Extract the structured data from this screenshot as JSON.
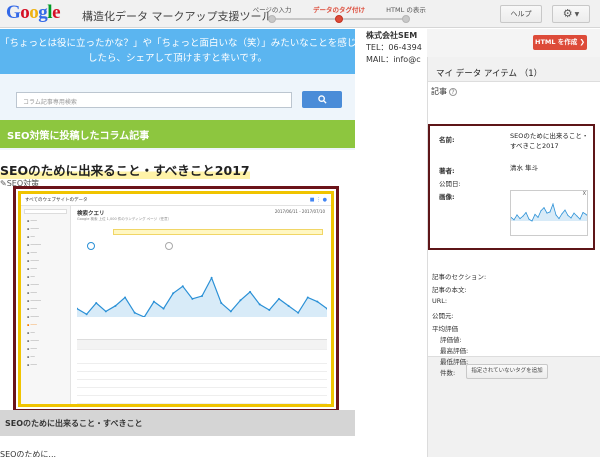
{
  "header": {
    "logo": [
      "G",
      "o",
      "o",
      "g",
      "l",
      "e"
    ],
    "title": "構造化データ マークアップ支援ツール",
    "steps": [
      "ページの入力",
      "データのタグ付け",
      "HTML の表示"
    ],
    "active_step": 1,
    "help_label": "ヘルプ",
    "gear_icon": "gear-icon"
  },
  "preview": {
    "banner_line1": "「ちょっとは役に立ったかな？」や「ちょっと面白いな（笑）」みたいなことを感じられま",
    "banner_line2": "したら、シェアして頂けますと幸いです。",
    "search_placeholder": "コラム記事専用検索",
    "search_icon": "magnifier-icon",
    "section_heading": "SEO対策に投稿したコラム記事",
    "post_title": "SEOのために出来ること・すべきこと2017",
    "post_category": "SEO対策",
    "next_heading": "SEOのために出来ること・すべきこと",
    "next_item": "SEOのために..."
  },
  "company": {
    "name": "株式会社SEM",
    "tel": "TEL：06-4394",
    "mail": "MAIL：info@c"
  },
  "html_button": "HTML を作成 ❯",
  "panel": {
    "title": "マイ データ アイテム （1）",
    "section": "記事",
    "fields": {
      "name_label": "名前:",
      "name_value": "SEOのために出来ること・すべきこと2017",
      "author_label": "著者:",
      "author_value": "清水 隼斗",
      "published_label": "公開日:",
      "image_label": "画像:",
      "section_label": "記事のセクション:",
      "body_label": "記事の本文:",
      "url_label": "URL:",
      "publisher_label": "公開元:",
      "rating_label": "平均評価",
      "rating_value_label": "評価値:",
      "best_label": "最高評価:",
      "worst_label": "最低評価:",
      "count_label": "件数:"
    },
    "add_button": "指定されていないタグを追加"
  },
  "ga_mock": {
    "brand": "すべてのウェブサイトのデータ",
    "heading": "検索クエリ",
    "subtitle": "Google 検索 上位 1,000 件のランディング ページ（任意）",
    "date": "2017/06/11 - 2017/07/10",
    "sparkline": [
      22,
      18,
      26,
      20,
      24,
      30,
      19,
      16,
      27,
      22,
      33,
      38,
      29,
      31,
      44,
      26,
      20,
      28,
      34,
      25,
      21,
      29,
      24,
      19,
      30,
      27,
      22
    ]
  }
}
